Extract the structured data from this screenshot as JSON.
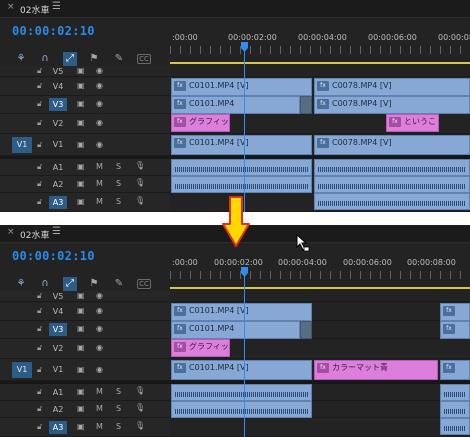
{
  "tab": {
    "title": "02水車",
    "close": "×",
    "menu": "☰"
  },
  "timecode": "00:00:02:10",
  "ruler_labels_top": [
    ":00:00",
    "00:00:02:00",
    "00:00:04:00",
    "00:00:06:00",
    "00:00:08:00"
  ],
  "ruler_labels_bottom": [
    ":00:00",
    "00:00:02:00",
    "00:00:04:00",
    "00:00:06:00",
    "00:00:08:00"
  ],
  "tracks": {
    "video": [
      "V5",
      "V4",
      "V3",
      "V2",
      "V1"
    ],
    "audio": [
      "A1",
      "A2",
      "A3"
    ],
    "source_v": "V1",
    "audio_mute": "M",
    "audio_solo": "S"
  },
  "clips_top": {
    "v4_a": "C0101.MP4 [V]",
    "v4_b": "C0078.MP4 [V]",
    "v3_a": "C0101.MP4",
    "v3_b": "C0078.MP4 [V]",
    "v2_a": "グラフィッ",
    "v2_b": "というこ",
    "v1_a": "C0101.MP4 [V]",
    "v1_b": "C0078.MP4 [V]"
  },
  "clips_bottom": {
    "v4_a": "C0101.MP4 [V]",
    "v3_a": "C0101.MP4",
    "v2_a": "グラフィッ",
    "v1_a": "C0101.MP4 [V]",
    "v1_b": "カラーマット青"
  },
  "colors": {
    "panel": "#232323",
    "accent_blue": "#2b8ae8",
    "video_clip": "#87a8d4",
    "graphic_clip": "#dc7fdc",
    "work_area": "#d6c64a",
    "arrow_fill": "#ffd800",
    "arrow_stroke": "#e03020"
  },
  "icons": {
    "lock": "lock-icon",
    "film": "film-icon",
    "eye": "eye-icon",
    "mic": "microphone-icon"
  }
}
